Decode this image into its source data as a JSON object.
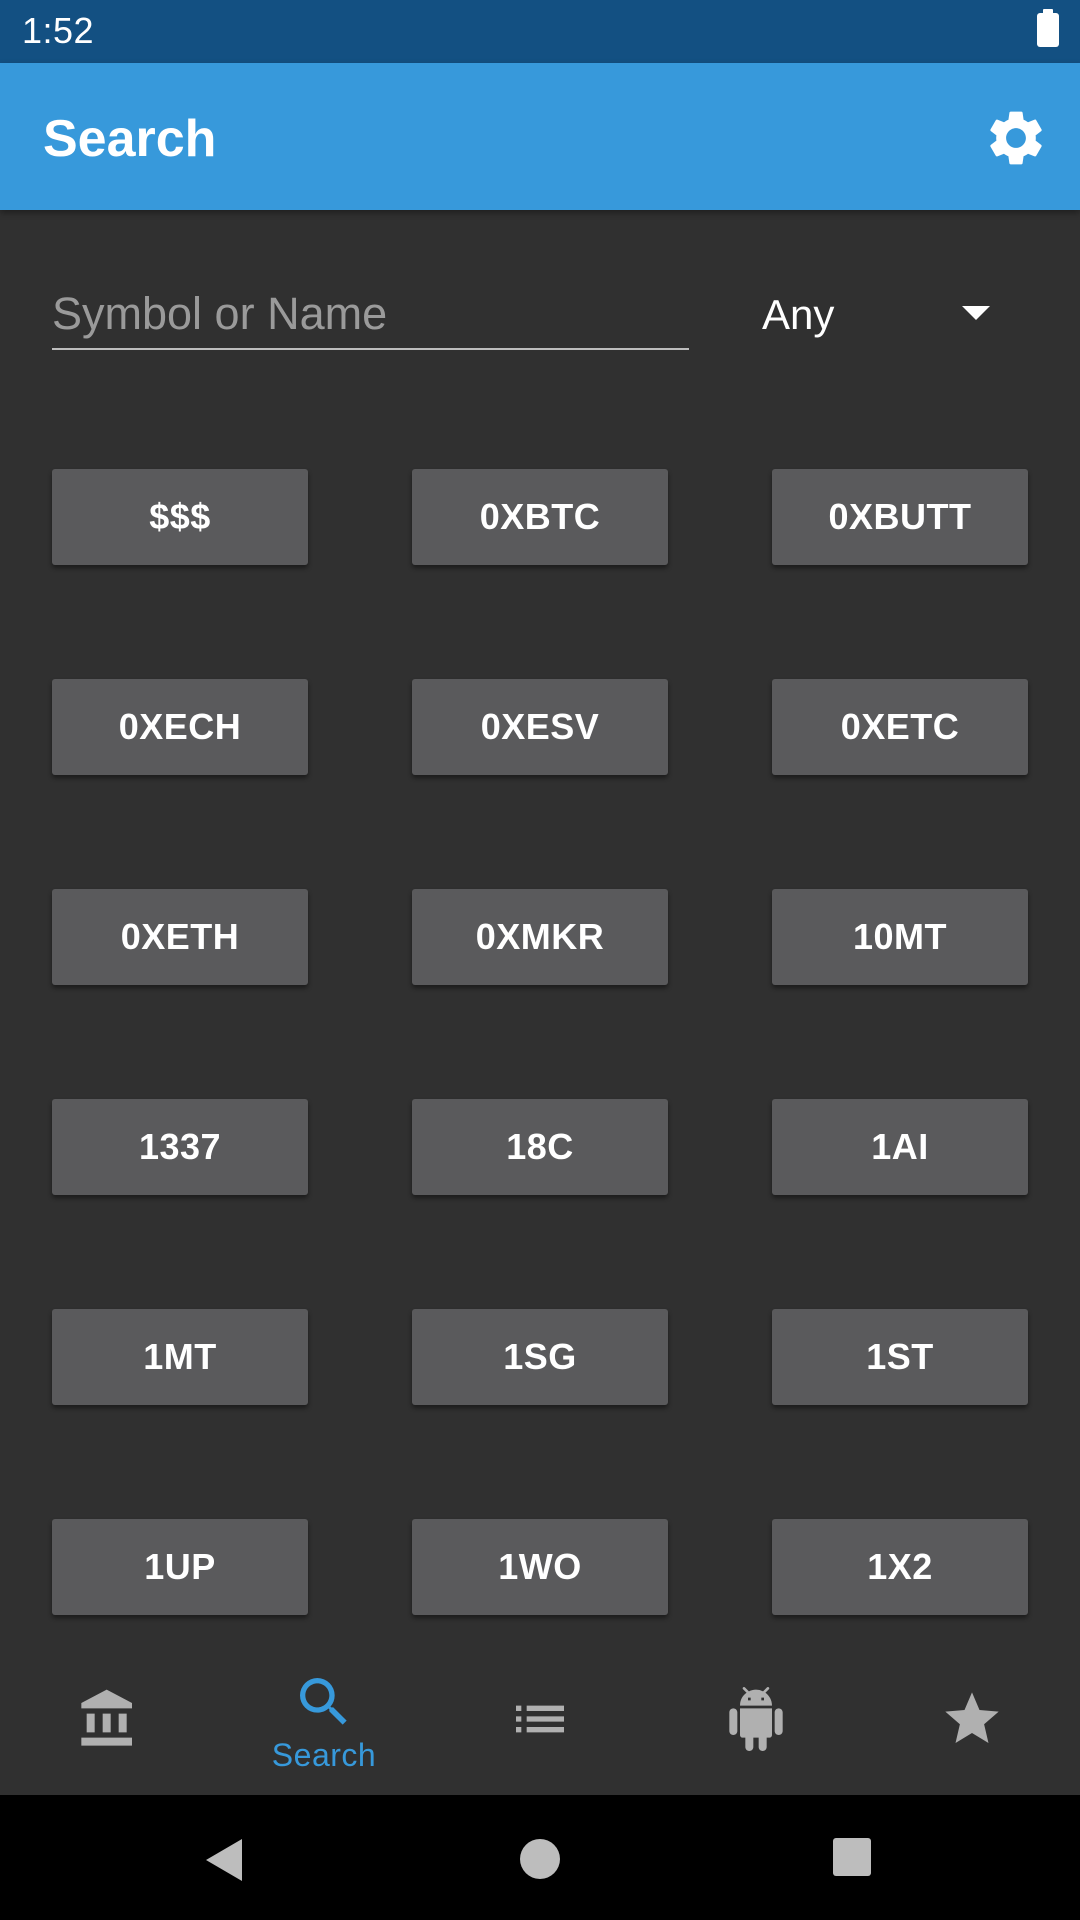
{
  "status_bar": {
    "time": "1:52"
  },
  "app_bar": {
    "title": "Search",
    "settings_icon": "gear-icon"
  },
  "search": {
    "placeholder": "Symbol or Name",
    "value": ""
  },
  "type_filter": {
    "selected": "Any"
  },
  "symbols": [
    "$$$",
    "0XBTC",
    "0XBUTT",
    "0XECH",
    "0XESV",
    "0XETC",
    "0XETH",
    "0XMKR",
    "10MT",
    "1337",
    "18C",
    "1AI",
    "1MT",
    "1SG",
    "1ST",
    "1UP",
    "1WO",
    "1X2"
  ],
  "bottom_nav": {
    "items": [
      {
        "icon": "bank-icon",
        "label": ""
      },
      {
        "icon": "search-icon",
        "label": "Search",
        "active": true
      },
      {
        "icon": "list-icon",
        "label": ""
      },
      {
        "icon": "android-icon",
        "label": ""
      },
      {
        "icon": "star-icon",
        "label": ""
      }
    ]
  },
  "system_nav": {
    "icons": [
      "back-icon",
      "home-icon",
      "recents-icon"
    ]
  },
  "colors": {
    "status_bar": "#135082",
    "app_bar": "#3799db",
    "background": "#303030",
    "button": "#5a5a5c",
    "accent": "#3799db",
    "inactive_icon": "#b0b0b0"
  }
}
